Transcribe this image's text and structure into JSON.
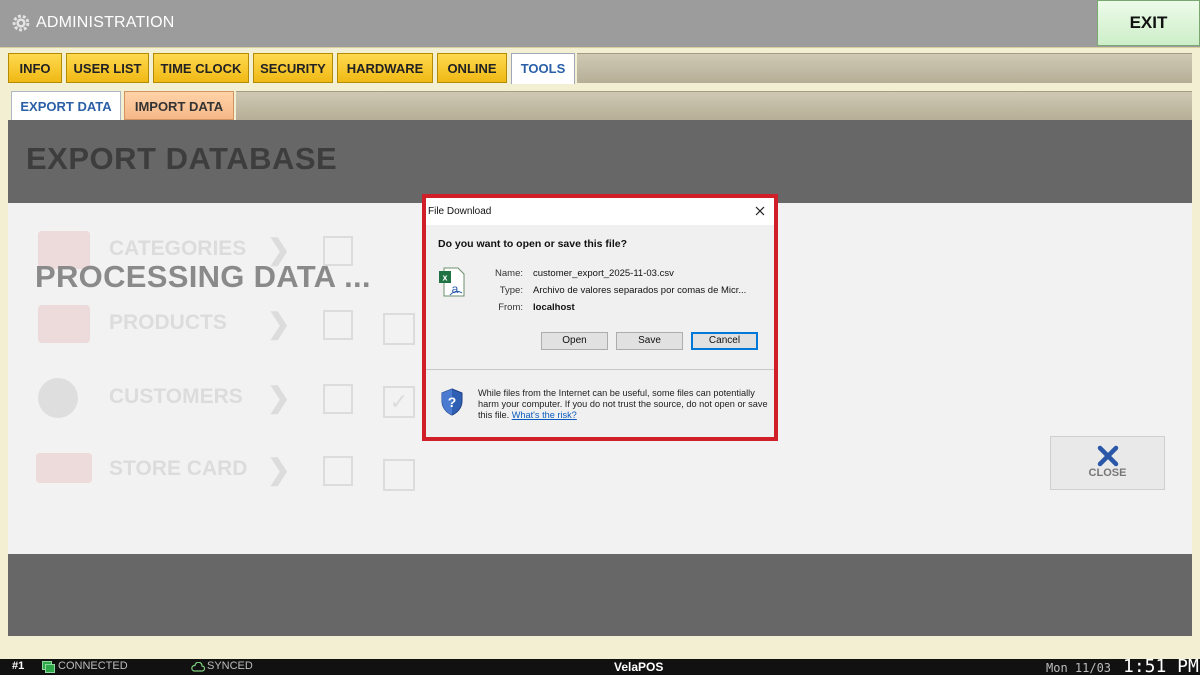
{
  "header": {
    "title": "ADMINISTRATION",
    "exit_label": "EXIT",
    "gear_icon": "gear-icon"
  },
  "tabs": {
    "main": [
      {
        "label": "INFO"
      },
      {
        "label": "USER LIST"
      },
      {
        "label": "TIME CLOCK"
      },
      {
        "label": "SECURITY"
      },
      {
        "label": "HARDWARE"
      },
      {
        "label": "ONLINE"
      },
      {
        "label": "TOOLS",
        "active": true
      }
    ],
    "sub": [
      {
        "label": "EXPORT DATA",
        "active": true
      },
      {
        "label": "IMPORT DATA"
      }
    ]
  },
  "page": {
    "title": "EXPORT DATABASE",
    "processing": "PROCESSING DATA ...",
    "rows": [
      {
        "label": "CATEGORIES"
      },
      {
        "label": "PRODUCTS"
      },
      {
        "label": "CUSTOMERS"
      },
      {
        "label": "STORE CARD"
      }
    ],
    "close_label": "CLOSE"
  },
  "dialog": {
    "title": "File Download",
    "question": "Do you want to open or save this file?",
    "name_key": "Name:",
    "name_value": "customer_export_2025-11-03.csv",
    "type_key": "Type:",
    "type_value": "Archivo de valores separados por comas de Micr...",
    "from_key": "From:",
    "from_value": "localhost",
    "buttons": {
      "open": "Open",
      "save": "Save",
      "cancel": "Cancel"
    },
    "warning_text": "While files from the Internet can be useful, some files can potentially harm your computer. If you do not trust the source, do not open or save this file.",
    "risk_link": "What's the risk?",
    "highlight_color": "#d11f2a"
  },
  "status": {
    "terminal": "#1",
    "connection": "CONNECTED",
    "sync": "SYNCED",
    "brand": "VelaPOS",
    "date": "Mon 11/03",
    "time": "1:51 PM"
  }
}
